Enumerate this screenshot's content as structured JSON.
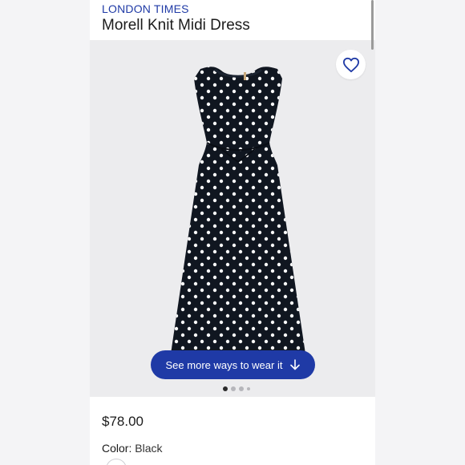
{
  "product": {
    "brand": "LONDON TIMES",
    "title": "Morell Knit Midi Dress",
    "price": "$78.00",
    "color_label": "Color:",
    "color_value": "Black"
  },
  "gallery": {
    "cta_label": "See more ways to wear it",
    "cta_icon": "arrow-down-icon",
    "favorite_icon": "heart-outline-icon",
    "page_count": 4,
    "active_page": 1
  },
  "colors": {
    "accent": "#1f3aa6",
    "dress": "#101620",
    "gallery_bg": "#ececee"
  }
}
